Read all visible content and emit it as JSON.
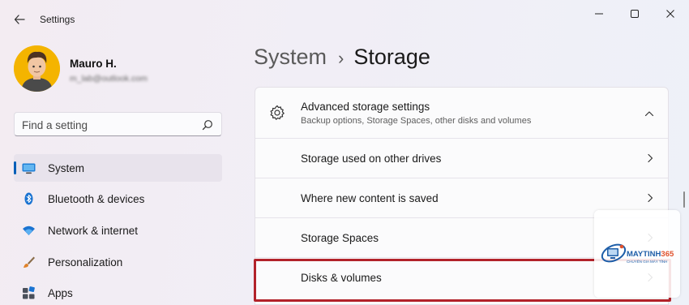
{
  "window": {
    "title": "Settings"
  },
  "profile": {
    "name": "Mauro H.",
    "email": "m_lab@outlook.com"
  },
  "search": {
    "placeholder": "Find a setting"
  },
  "sidebar": {
    "items": [
      {
        "label": "System",
        "icon": "monitor-icon",
        "active": true
      },
      {
        "label": "Bluetooth & devices",
        "icon": "bluetooth-icon",
        "active": false
      },
      {
        "label": "Network & internet",
        "icon": "wifi-icon",
        "active": false
      },
      {
        "label": "Personalization",
        "icon": "paintbrush-icon",
        "active": false
      },
      {
        "label": "Apps",
        "icon": "apps-icon",
        "active": false
      }
    ]
  },
  "breadcrumb": {
    "parent": "System",
    "separator": "›",
    "current": "Storage"
  },
  "advanced": {
    "title": "Advanced storage settings",
    "subtitle": "Backup options, Storage Spaces, other disks and volumes",
    "expanded": true
  },
  "rows": [
    {
      "label": "Storage used on other drives"
    },
    {
      "label": "Where new content is saved"
    },
    {
      "label": "Storage Spaces"
    },
    {
      "label": "Disks & volumes",
      "highlighted": true
    }
  ],
  "watermark": {
    "brand_part1": "MAYTINH",
    "brand_part2": "365",
    "tagline": "CHUYÊN GIA MÁY TÍNH"
  },
  "colors": {
    "accent": "#005fb8",
    "highlight": "#b2222a"
  }
}
